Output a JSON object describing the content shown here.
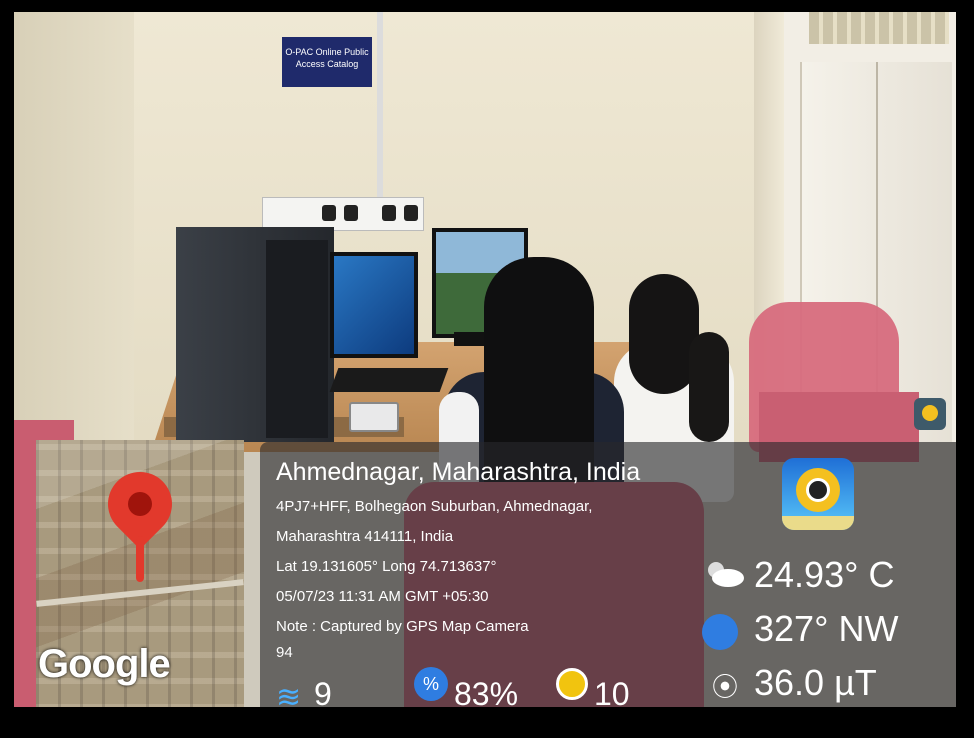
{
  "sign": {
    "line1": "O-PAC Online Public",
    "line2": "Access Catalog"
  },
  "overlay": {
    "map_brand": "Google",
    "title": "Ahmednagar, Maharashtra, India",
    "address_line1": "4PJ7+HFF, Bolhegaon Suburban, Ahmednagar,",
    "address_line2": "Maharashtra 414111, India",
    "coords": "Lat 19.131605° Long 74.713637°",
    "datetime": "05/07/23 11:31 AM GMT +05:30",
    "note": "Note : Captured by GPS Map Camera",
    "extra": "94",
    "temperature": "24.93° C",
    "direction": "327° NW",
    "magnetic": "36.0 µT",
    "wind": "9",
    "humidity": "83%",
    "pressure": "10"
  },
  "icons": {
    "map_pin": "location-pin-icon",
    "app": "gps-map-camera-app-icon",
    "weather": "cloud-sun-icon",
    "compass": "compass-icon",
    "magnetic": "magnetic-field-icon",
    "wind": "wind-icon",
    "humidity": "humidity-icon",
    "pressure": "pressure-gauge-icon"
  }
}
